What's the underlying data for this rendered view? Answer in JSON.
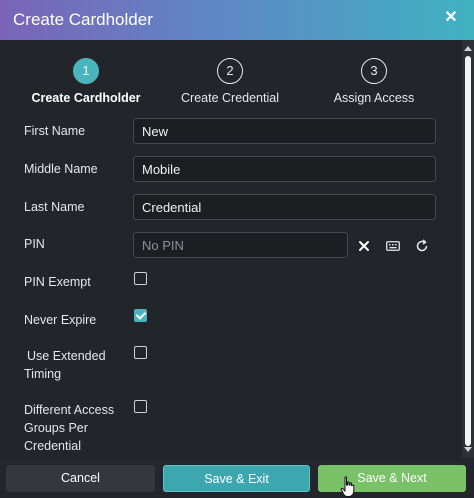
{
  "dialog": {
    "title": "Create Cardholder",
    "close_glyph": "✕"
  },
  "stepper": {
    "steps": [
      {
        "number": "1",
        "label": "Create Cardholder",
        "active": true
      },
      {
        "number": "2",
        "label": "Create Credential",
        "active": false
      },
      {
        "number": "3",
        "label": "Assign Access",
        "active": false
      }
    ]
  },
  "form": {
    "first_name": {
      "label": "First Name",
      "value": "New"
    },
    "middle_name": {
      "label": "Middle Name",
      "value": "Mobile"
    },
    "last_name": {
      "label": "Last Name",
      "value": "Credential"
    },
    "pin": {
      "label": "PIN",
      "value": "",
      "placeholder": "No PIN"
    },
    "pin_exempt": {
      "label": "PIN Exempt",
      "checked": false
    },
    "never_expire": {
      "label": "Never Expire",
      "checked": true
    },
    "extended_timing": {
      "label_line1": "Use Extended",
      "label_line2": "Timing",
      "checked": false
    },
    "different_access": {
      "label_line1": "Different Access",
      "label_line2": "Groups Per",
      "label_line3": "Credential",
      "checked": false
    }
  },
  "footer": {
    "cancel_label": "Cancel",
    "save_exit_label": "Save & Exit",
    "save_next_label": "Save & Next"
  },
  "icons": {
    "clear_pin": "clear-icon",
    "keypad": "keyboard-icon",
    "regenerate": "refresh-icon"
  },
  "colors": {
    "accent": "#4ab4bc",
    "save_next": "#79c267",
    "title_gradient_start": "#7b64b8",
    "title_gradient_end": "#3fb2c2"
  }
}
